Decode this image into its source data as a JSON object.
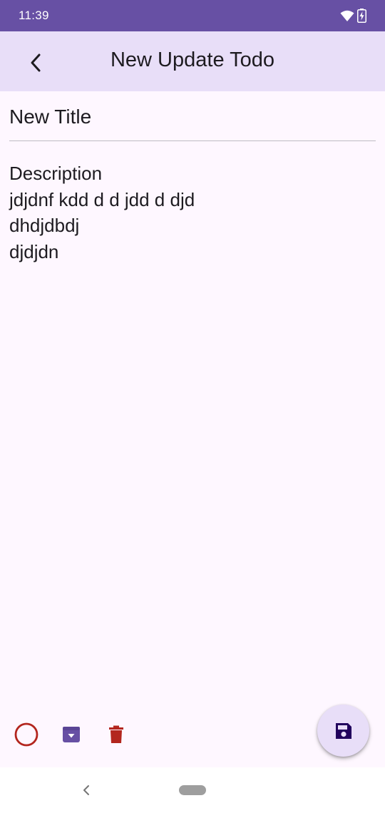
{
  "status_bar": {
    "time": "11:39",
    "icons": [
      "wifi-icon",
      "battery-charging-icon"
    ]
  },
  "app_bar": {
    "title": "New Update Todo",
    "back_icon": "chevron-left-icon"
  },
  "form": {
    "title_value": "New Title",
    "description_lines": [
      "Description",
      "jdjdnf kdd d d jdd d djd",
      "dhdjdbdj",
      "djdjdn"
    ]
  },
  "actions": [
    {
      "name": "complete-toggle",
      "icon": "circle-outline-icon",
      "color": "#b3261e"
    },
    {
      "name": "archive",
      "icon": "archive-icon",
      "color": "#6750a4"
    },
    {
      "name": "delete",
      "icon": "trash-icon",
      "color": "#b3261e"
    }
  ],
  "fab": {
    "icon": "save-icon",
    "color": "#21005d"
  },
  "colors": {
    "primary": "#6750a4",
    "surface": "#fef7ff",
    "app_bar": "#e8def8",
    "error": "#b3261e"
  }
}
